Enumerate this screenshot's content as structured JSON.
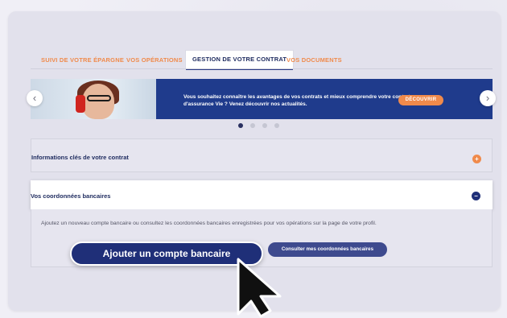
{
  "tabs": [
    {
      "label": "SUIVI DE VOTRE ÉPARGNE"
    },
    {
      "label": "VOS OPÉRATIONS"
    },
    {
      "label": "GESTION DE VOTRE CONTRAT",
      "active": true
    },
    {
      "label": "VOS DOCUMENTS"
    }
  ],
  "banner": {
    "text": "Vous souhaitez connaître les avantages de vos contrats et mieux comprendre votre contrat d'assurance Vie ? Venez découvrir nos actualités.",
    "button_label": "DÉCOUVRIR",
    "prev_icon": "chevron-left-icon",
    "next_icon": "chevron-right-icon",
    "pagination": {
      "count": 4,
      "active_index": 0
    }
  },
  "accordion": [
    {
      "title": "Informations clés de votre contrat",
      "state": "collapsed"
    },
    {
      "title": "Vos coordonnées bancaires",
      "state": "expanded"
    }
  ],
  "bank_section": {
    "description": "Ajoutez un nouveau compte bancaire ou consultez les coordonnées bancaires enregistrées pour vos opérations sur la page de votre profil.",
    "add_button": "Ajouter un compte bancaire",
    "view_button": "Consulter mes coordonnées bancaires"
  },
  "colors": {
    "accent": "#f08a4b",
    "primary": "#1f2f78",
    "banner": "#1f3b8c"
  }
}
